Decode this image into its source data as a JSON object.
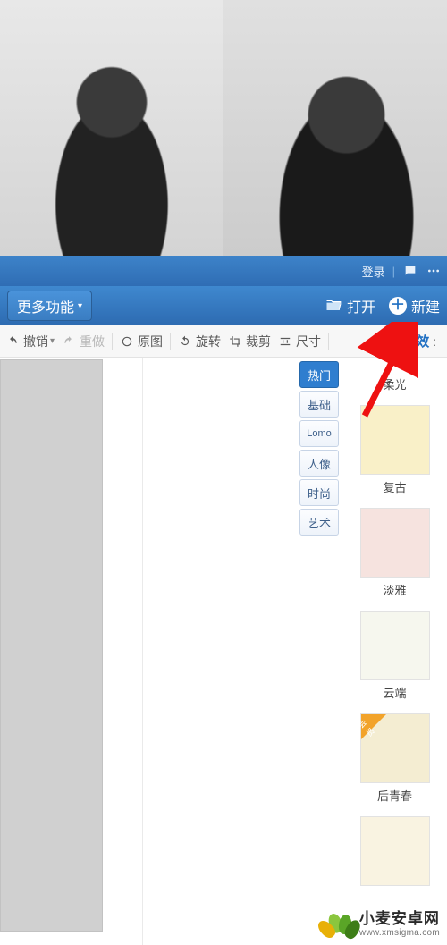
{
  "titlebar": {
    "login": "登录"
  },
  "maintoolbar": {
    "more": "更多功能",
    "open": "打开",
    "new": "新建"
  },
  "subtoolbar": {
    "undo": "撤销",
    "redo": "重做",
    "original": "原图",
    "rotate": "旋转",
    "crop": "裁剪",
    "size": "尺寸"
  },
  "side_panel": {
    "title": "特效",
    "categories": [
      "热门",
      "基础",
      "Lomo",
      "人像",
      "时尚",
      "艺术"
    ],
    "active_index": 0,
    "effects": [
      {
        "name": "柔光",
        "color": "#f9f0c8"
      },
      {
        "name": "复古",
        "color": "#f6e3df"
      },
      {
        "name": "淡雅",
        "color": "#f6f7ee"
      },
      {
        "name": "云端",
        "color": "#f4edd2",
        "vip": true,
        "vip_label": "会员"
      },
      {
        "name": "后青春",
        "color": "#f9f3e1"
      }
    ]
  },
  "watermark": {
    "name": "小麦安卓网",
    "url": "www.xmsigma.com"
  }
}
